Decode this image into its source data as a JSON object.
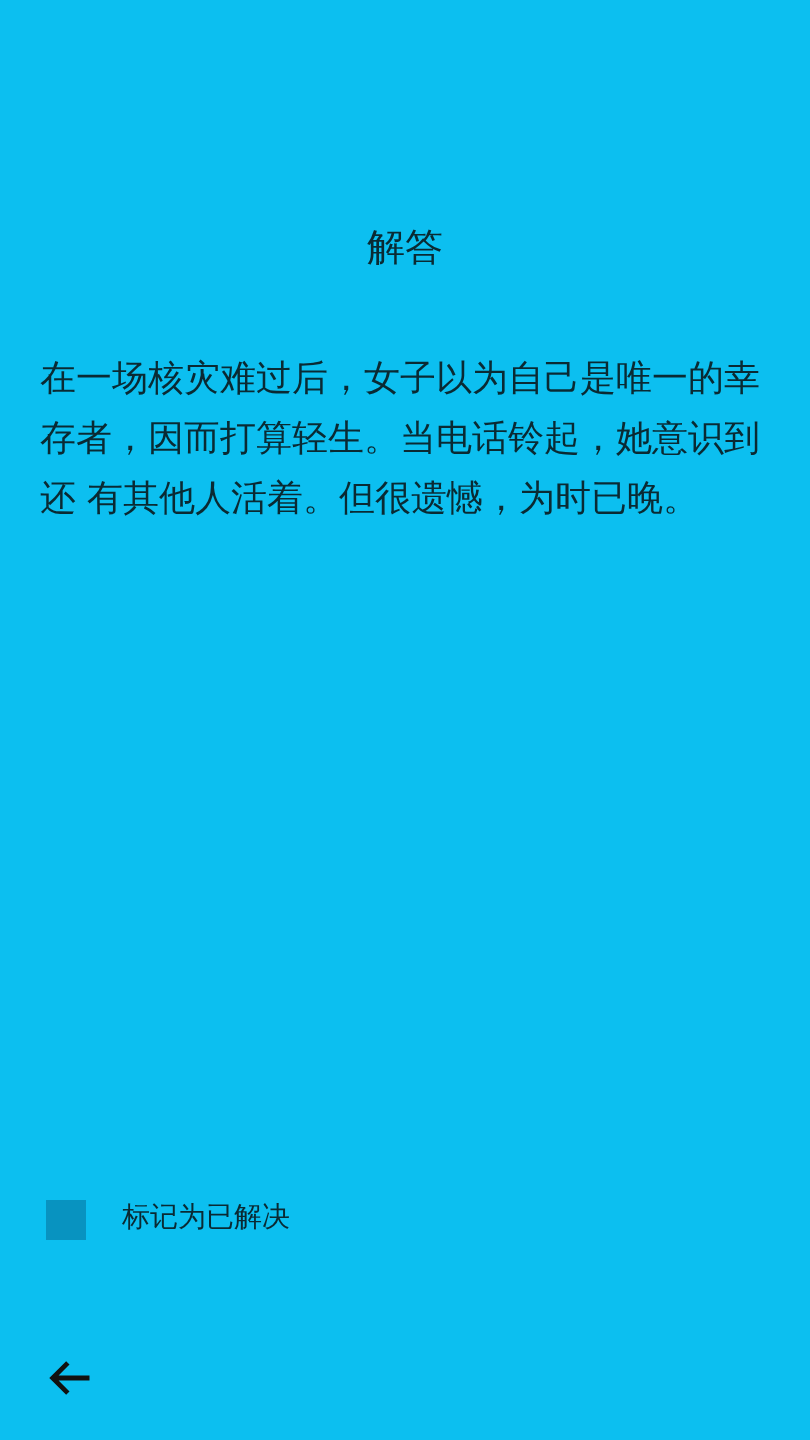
{
  "title": "解答",
  "answer": "在一场核灾难过后，女子以为自己是唯一的幸存者，因而打算轻生。当电话铃起，她意识到还 有其他人活着。但很遗憾，为时已晚。",
  "solved_checkbox": {
    "label": "标记为已解决",
    "checked": false
  }
}
